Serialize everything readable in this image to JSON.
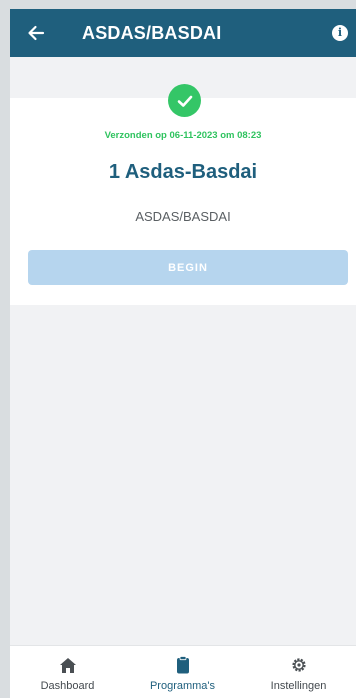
{
  "header": {
    "title": "ASDAS/BASDAI",
    "back_icon": "arrow-left-icon",
    "info_icon": "info-icon",
    "info_glyph": "i",
    "color": "#1f5f7d"
  },
  "status": {
    "icon": "check-circle-icon",
    "sent_text": "Verzonden op 06-11-2023 om 08:23",
    "color": "#34c667"
  },
  "program": {
    "title": "1 Asdas-Basdai",
    "subtitle": "ASDAS/BASDAI"
  },
  "actions": {
    "begin_label": "BEGIN",
    "begin_color": "#b6d5ee"
  },
  "bottom_nav": {
    "items": [
      {
        "label": "Dashboard",
        "icon": "home-icon"
      },
      {
        "label": "Programma's",
        "icon": "clipboard-icon",
        "active": true
      },
      {
        "label": "Instellingen",
        "icon": "gear-icon"
      }
    ]
  }
}
